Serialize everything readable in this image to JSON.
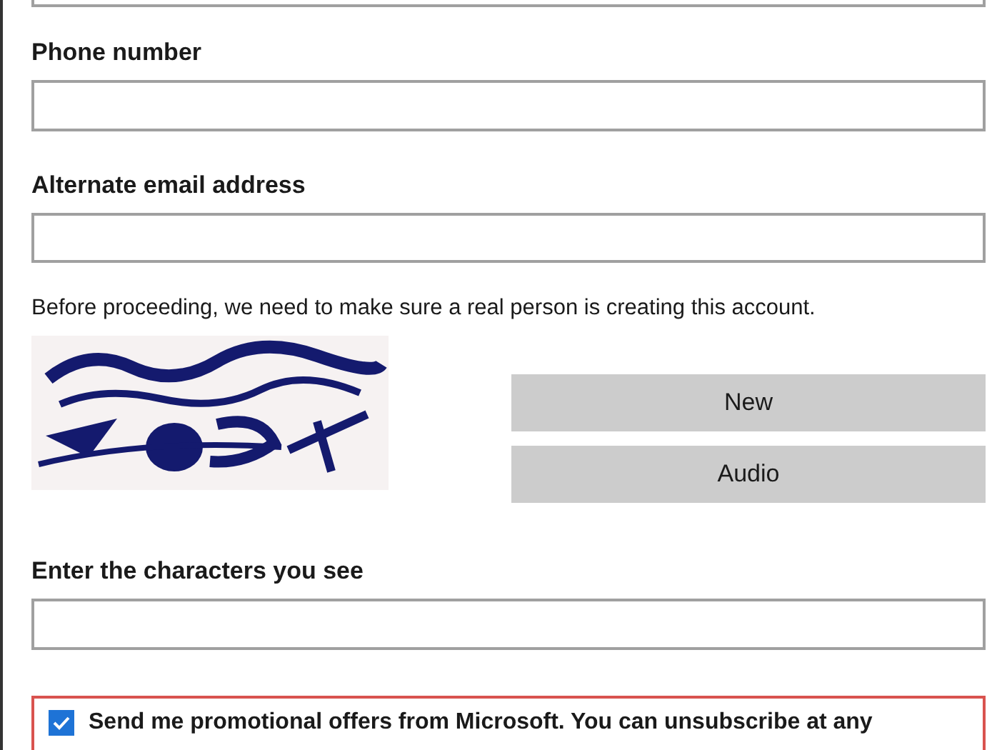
{
  "fields": [
    {
      "kind": "cut"
    },
    {
      "kind": "labeled",
      "label": "Phone number"
    },
    {
      "kind": "labeled",
      "label": "Alternate email address"
    }
  ],
  "captcha": {
    "prompt": "Before proceeding, we need to make sure a real person is creating this account.",
    "image": {
      "kind": "picture"
    },
    "buttons": [
      "New",
      "Audio"
    ],
    "label": "Enter the characters you see"
  },
  "promo": {
    "checked": true,
    "text": "Send me promotional offers from Microsoft. You can unsubscribe at any"
  }
}
